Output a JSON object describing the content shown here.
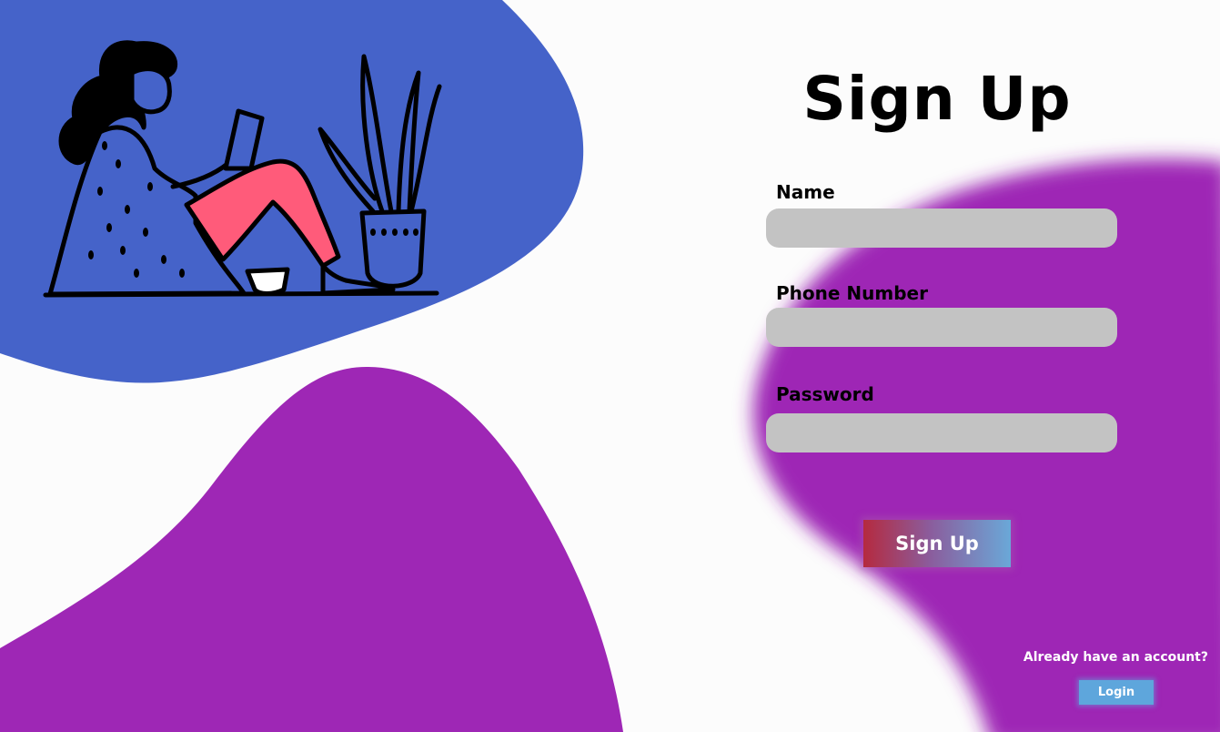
{
  "form": {
    "title": "Sign Up",
    "fields": [
      {
        "label": "Name",
        "value": "",
        "placeholder": ""
      },
      {
        "label": "Phone Number",
        "value": "",
        "placeholder": ""
      },
      {
        "label": "Password",
        "value": "",
        "placeholder": ""
      }
    ],
    "submit_label": "Sign Up"
  },
  "footer": {
    "prompt": "Already have an account?",
    "login_label": "Login"
  },
  "illustration": {
    "icon": "woman-reading-icon"
  },
  "colors": {
    "blue_blob": "#4563c9",
    "purple_blob": "#9e27b5",
    "input_bg": "#c3c3c3",
    "skin_pants": "#ff5b7a",
    "login_button": "#5ea6dc"
  }
}
